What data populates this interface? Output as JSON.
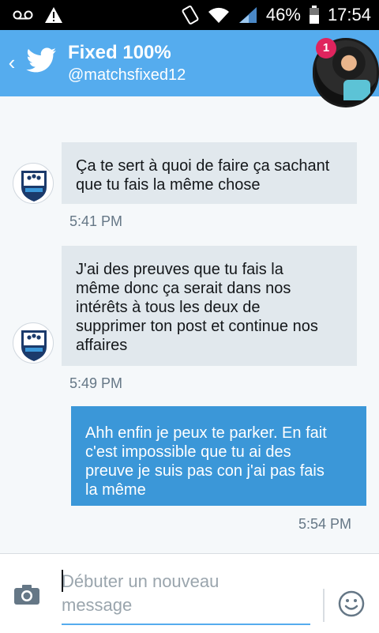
{
  "status_bar": {
    "battery_percent": "46%",
    "time": "17:54",
    "icons": [
      "voicemail-icon",
      "warning-icon",
      "vibrate-icon",
      "wifi-icon",
      "signal-icon",
      "battery-icon"
    ]
  },
  "header": {
    "title": "Fixed 100%",
    "handle": "@matchsfixed12",
    "badge_count": "1"
  },
  "messages": [
    {
      "sender": "other",
      "text_lines": [
        "Ça te sert à quoi de faire ça sachant",
        "que tu fais la même chose"
      ],
      "time": "5:41 PM"
    },
    {
      "sender": "other",
      "text_lines": [
        "J'ai des preuves que tu fais la",
        "même donc ça serait dans nos",
        "intérêts à tous les deux de",
        "supprimer ton post et continue nos",
        "affaires"
      ],
      "time": "5:49 PM"
    },
    {
      "sender": "me",
      "text_lines": [
        "Ahh enfin je peux te parker. En fait",
        "c'est impossible que tu ai des",
        "preuve je suis pas con j'ai pas fais",
        "la même"
      ],
      "time": "5:54 PM"
    }
  ],
  "composer": {
    "placeholder_lines": [
      "Débuter un nouveau",
      "message"
    ]
  },
  "colors": {
    "header": "#55acee",
    "bubble_other": "#e1e8ed",
    "bubble_me": "#3b97d8",
    "background": "#f5f8fa"
  }
}
